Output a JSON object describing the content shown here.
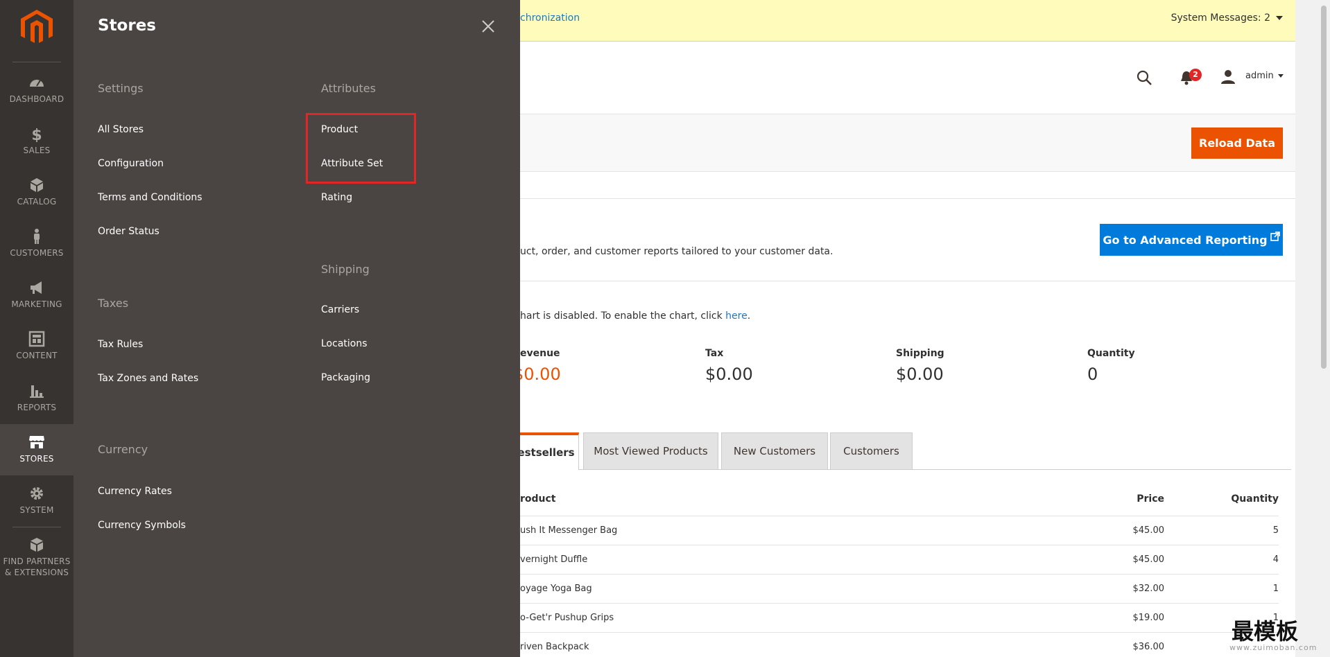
{
  "nav": {
    "items": [
      {
        "label": "DASHBOARD",
        "icon": "dashboard-icon"
      },
      {
        "label": "SALES",
        "icon": "dollar-icon"
      },
      {
        "label": "CATALOG",
        "icon": "box-icon"
      },
      {
        "label": "CUSTOMERS",
        "icon": "person-icon"
      },
      {
        "label": "MARKETING",
        "icon": "megaphone-icon"
      },
      {
        "label": "CONTENT",
        "icon": "layout-icon"
      },
      {
        "label": "REPORTS",
        "icon": "bar-chart-icon"
      },
      {
        "label": "STORES",
        "icon": "storefront-icon",
        "active": true
      },
      {
        "label": "SYSTEM",
        "icon": "gear-icon"
      },
      {
        "label": "FIND PARTNERS",
        "label2": "& EXTENSIONS",
        "icon": "cube-stack-icon"
      }
    ]
  },
  "flyout": {
    "title": "Stores",
    "settings": {
      "heading": "Settings",
      "links": [
        "All Stores",
        "Configuration",
        "Terms and Conditions",
        "Order Status"
      ]
    },
    "taxes": {
      "heading": "Taxes",
      "links": [
        "Tax Rules",
        "Tax Zones and Rates"
      ]
    },
    "currency": {
      "heading": "Currency",
      "links": [
        "Currency Rates",
        "Currency Symbols"
      ]
    },
    "attributes": {
      "heading": "Attributes",
      "links": [
        "Product",
        "Attribute Set",
        "Rating"
      ]
    },
    "shipping": {
      "heading": "Shipping",
      "links": [
        "Carriers",
        "Locations",
        "Packaging"
      ]
    }
  },
  "content": {
    "message_link": "chronization",
    "system_messages": "System Messages: 2",
    "notification_count": "2",
    "admin_user": "admin",
    "reload_button": "Reload Data",
    "advanced_text": "uct, order, and customer reports tailored to your customer data.",
    "advanced_button": "Go to Advanced Reporting",
    "chart_note_prefix": "hart is disabled. To enable the chart, click ",
    "chart_note_link": "here",
    "chart_note_suffix": ".",
    "stats": [
      {
        "label": "evenue",
        "value": "$0.00"
      },
      {
        "label": "Tax",
        "value": "$0.00"
      },
      {
        "label": "Shipping",
        "value": "$0.00"
      },
      {
        "label": "Quantity",
        "value": "0"
      }
    ],
    "tabs": [
      "estsellers",
      "Most Viewed Products",
      "New Customers",
      "Customers"
    ],
    "table": {
      "headers": {
        "product": "roduct",
        "price": "Price",
        "quantity": "Quantity"
      },
      "rows": [
        {
          "product": "ush It Messenger Bag",
          "price": "$45.00",
          "qty": "5"
        },
        {
          "product": "vernight Duffle",
          "price": "$45.00",
          "qty": "4"
        },
        {
          "product": "oyage Yoga Bag",
          "price": "$32.00",
          "qty": "1"
        },
        {
          "product": "o-Get'r Pushup Grips",
          "price": "$19.00",
          "qty": "1"
        },
        {
          "product": "riven Backpack",
          "price": "$36.00",
          "qty": ""
        }
      ]
    }
  },
  "watermark": {
    "text": "最模板",
    "url": "www.zuimoban.com"
  },
  "colors": {
    "nav_bg": "#373330",
    "flyout_bg": "#4a4542",
    "logo_orange": "#eb5202",
    "highlight_red": "#e22626",
    "primary_blue": "#007bdb"
  }
}
